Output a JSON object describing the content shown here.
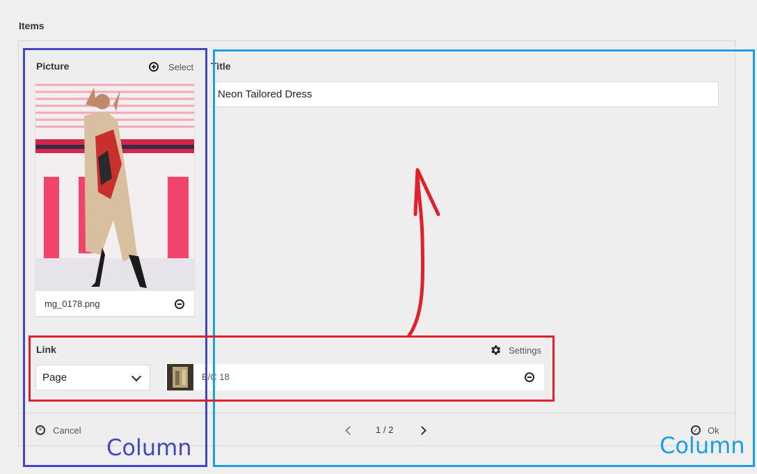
{
  "section": {
    "title": "Items"
  },
  "picture": {
    "label": "Picture",
    "select_label": "Select",
    "filename": "mg_0178.png"
  },
  "title_field": {
    "label": "Title",
    "value": "Neon Tailored Dress"
  },
  "link": {
    "label": "Link",
    "settings_label": "Settings",
    "type_value": "Page",
    "page_value": "E/C 18"
  },
  "footer": {
    "cancel_label": "Cancel",
    "pager": "1 / 2",
    "ok_label": "Ok"
  },
  "annotations": {
    "left_column": "Column",
    "right_column": "Column"
  },
  "colors": {
    "annotation_purple": "#4545c2",
    "annotation_blue": "#1a9fe0",
    "annotation_red": "#e0202c"
  }
}
